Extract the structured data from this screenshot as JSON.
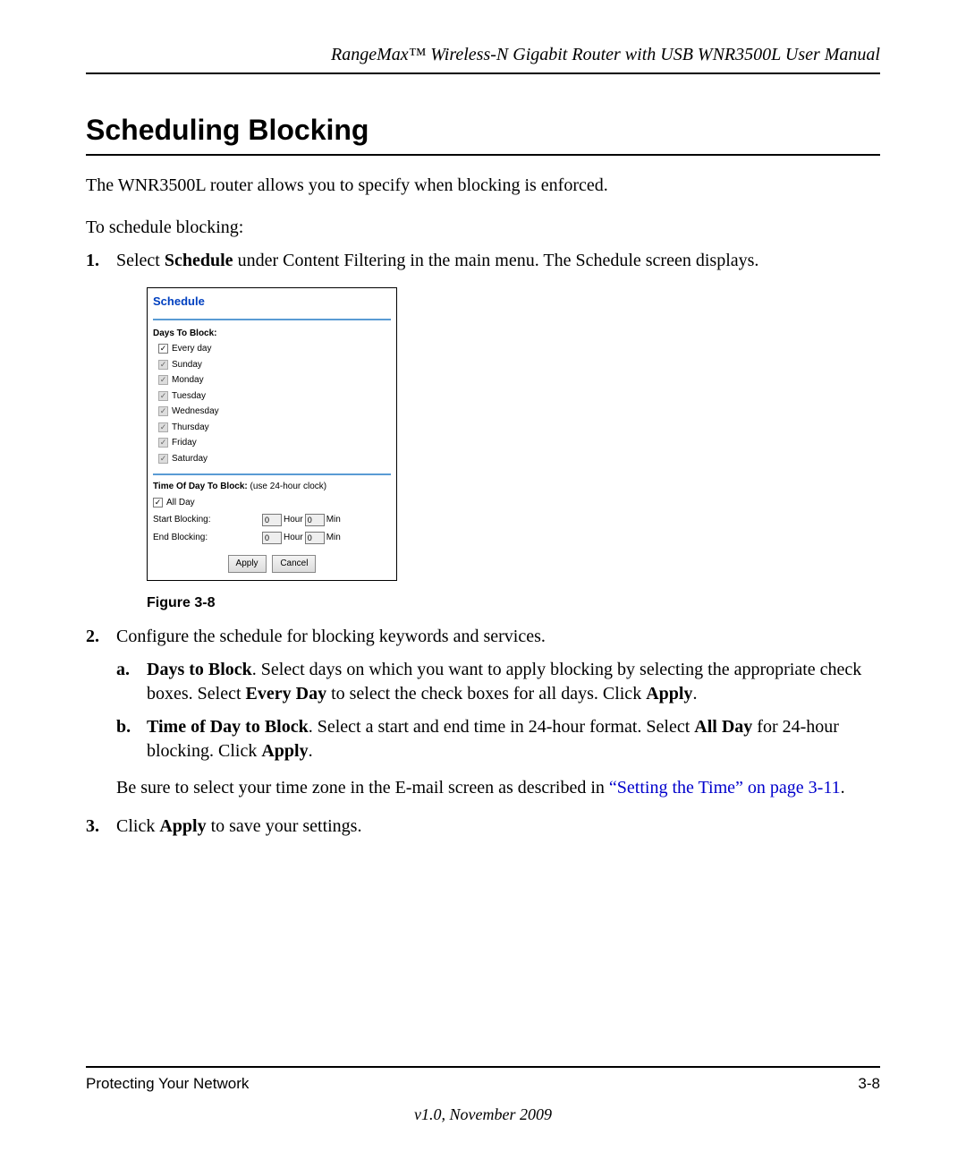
{
  "header": {
    "running": "RangeMax™ Wireless-N Gigabit Router with USB WNR3500L User Manual"
  },
  "title": "Scheduling Blocking",
  "intro1": "The WNR3500L router allows you to specify when blocking is enforced.",
  "intro2": "To schedule blocking:",
  "step1": {
    "num": "1.",
    "pre": "Select ",
    "bold": "Schedule",
    "post": " under Content Filtering in the main menu. The Schedule screen displays."
  },
  "figure": {
    "caption": "Figure 3-8"
  },
  "step2": {
    "num": "2.",
    "text": "Configure the schedule for blocking keywords and services.",
    "a": {
      "let": "a.",
      "b1": "Days to Block",
      "t1": ". Select days on which you want to apply blocking by selecting the appropriate check boxes. Select ",
      "b2": "Every Day",
      "t2": " to select the check boxes for all days. Click ",
      "b3": "Apply",
      "t3": "."
    },
    "b": {
      "let": "b.",
      "b1": "Time of Day to Block",
      "t1": ". Select a start and end time in 24-hour format. Select ",
      "b2": "All Day",
      "t2": " for 24-hour blocking. Click ",
      "b3": "Apply",
      "t3": "."
    },
    "tail_pre": "Be sure to select your time zone in the E-mail screen as described in ",
    "tail_link": "“Setting the Time” on page 3-11",
    "tail_post": "."
  },
  "step3": {
    "num": "3.",
    "pre": "Click ",
    "bold": "Apply",
    "post": " to save your settings."
  },
  "footer": {
    "left": "Protecting Your Network",
    "right": "3-8",
    "version": "v1.0, November 2009"
  },
  "ss": {
    "title": "Schedule",
    "days_head": "Days To Block:",
    "days": [
      {
        "label": "Every day",
        "checked": true,
        "enabled": true
      },
      {
        "label": "Sunday",
        "checked": true,
        "enabled": false
      },
      {
        "label": "Monday",
        "checked": true,
        "enabled": false
      },
      {
        "label": "Tuesday",
        "checked": true,
        "enabled": false
      },
      {
        "label": "Wednesday",
        "checked": true,
        "enabled": false
      },
      {
        "label": "Thursday",
        "checked": true,
        "enabled": false
      },
      {
        "label": "Friday",
        "checked": true,
        "enabled": false
      },
      {
        "label": "Saturday",
        "checked": true,
        "enabled": false
      }
    ],
    "time_head_bold": "Time Of Day To Block:",
    "time_head_rest": " (use 24-hour clock)",
    "allday": {
      "label": "All Day",
      "checked": true
    },
    "start_label": "Start Blocking:",
    "end_label": "End Blocking:",
    "hour_unit": "Hour",
    "min_unit": "Min",
    "start_hour": "0",
    "start_min": "0",
    "end_hour": "0",
    "end_min": "0",
    "apply": "Apply",
    "cancel": "Cancel"
  }
}
